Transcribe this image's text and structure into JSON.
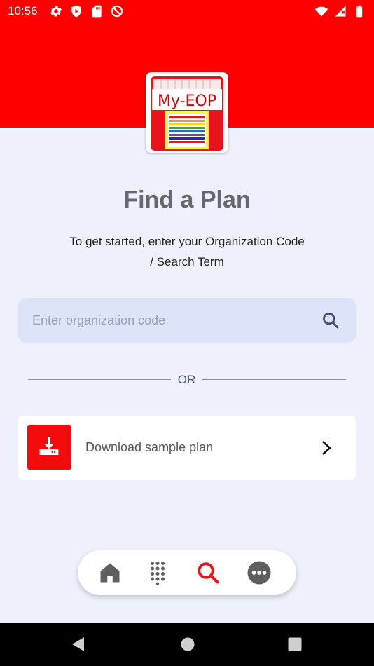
{
  "status_bar": {
    "time": "10:56",
    "left_icons": [
      "settings-icon",
      "shield-icon",
      "sd-card-icon",
      "do-not-disturb-icon"
    ],
    "right_icons": [
      "wifi-icon",
      "signal-icon",
      "battery-icon"
    ]
  },
  "app": {
    "logo_text": "My-EOP",
    "brand_color": "#ff0000"
  },
  "main": {
    "title": "Find a Plan",
    "subtitle": "To get started, enter your Organization Code / Search Term",
    "search": {
      "placeholder": "Enter organization code",
      "value": ""
    },
    "divider_text": "OR",
    "download_card": {
      "label": "Download sample plan",
      "icon": "download-icon",
      "action_icon": "chevron-right-icon"
    }
  },
  "bottom_nav": {
    "items": [
      {
        "name": "home",
        "icon": "home-icon",
        "active": false
      },
      {
        "name": "dialpad",
        "icon": "dialpad-icon",
        "active": false
      },
      {
        "name": "search",
        "icon": "search-icon",
        "active": true
      },
      {
        "name": "more",
        "icon": "more-icon",
        "active": false
      }
    ],
    "active_color": "#e8141c",
    "inactive_color": "#5f5f5f"
  },
  "system_nav": {
    "buttons": [
      "back-icon",
      "home-circle-icon",
      "recent-apps-icon"
    ]
  }
}
